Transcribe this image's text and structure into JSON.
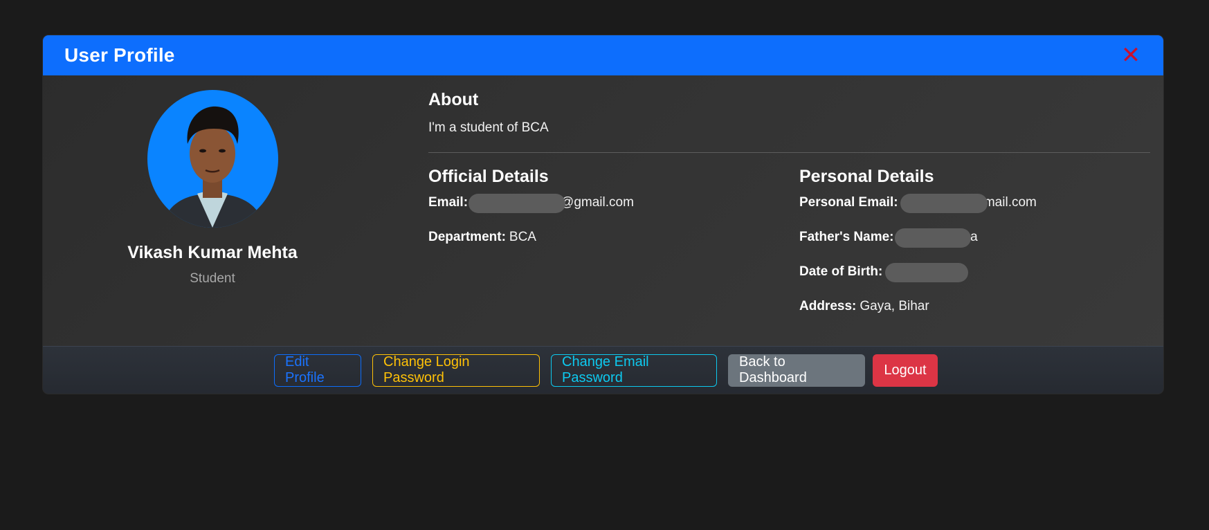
{
  "modal": {
    "title": "User Profile",
    "close_glyph": "✕"
  },
  "profile": {
    "name": "Vikash Kumar Mehta",
    "role": "Student"
  },
  "about": {
    "heading": "About",
    "text": "I'm a student of BCA"
  },
  "official": {
    "heading": "Official Details",
    "email_label": "Email:",
    "email_value": "@gmail.com",
    "department_label": "Department:",
    "department_value": "BCA"
  },
  "personal": {
    "heading": "Personal Details",
    "email_label": "Personal Email:",
    "email_value": "vi                    mail.com",
    "father_label": "Father's Name:",
    "father_value": "                    a",
    "dob_label": "Date of Birth:",
    "dob_value": "",
    "address_label": "Address:",
    "address_value": "Gaya, Bihar"
  },
  "footer": {
    "edit_profile": "Edit Profile",
    "change_login_password": "Change Login Password",
    "change_email_password": "Change Email Password",
    "back_to_dashboard": "Back to Dashboard",
    "logout": "Logout"
  },
  "colors": {
    "header": "#0d6efd",
    "close": "#c8102e",
    "background": "#1b1b1b",
    "primary": "#0d6efd",
    "warning": "#ffc107",
    "info": "#0dcaf0",
    "secondary": "#6c757d",
    "danger": "#dc3545"
  },
  "icons": {
    "close": "close-icon",
    "avatar": "profile-photo"
  }
}
